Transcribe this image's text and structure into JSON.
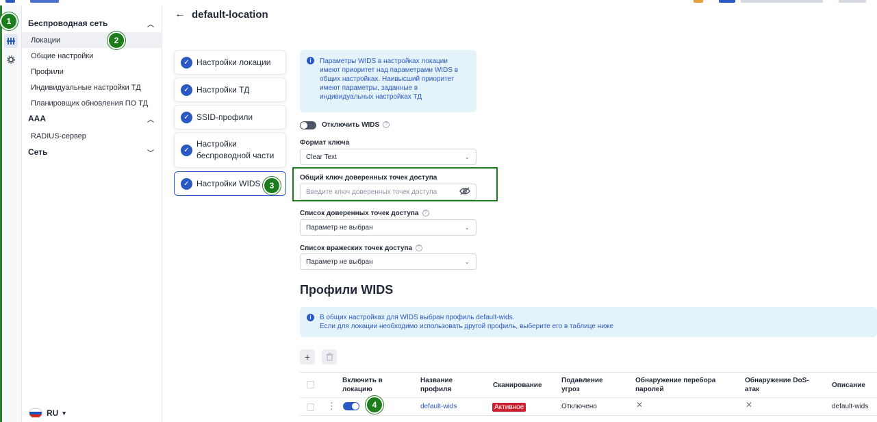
{
  "sidebar": {
    "sections": [
      {
        "label": "Беспроводная сеть"
      },
      {
        "label": "AAA"
      },
      {
        "label": "Сеть"
      }
    ],
    "items": [
      {
        "label": "Локации"
      },
      {
        "label": "Общие настройки"
      },
      {
        "label": "Профили"
      },
      {
        "label": "Индивидуальные настройки ТД"
      },
      {
        "label": "Планировщик обновления ПО ТД"
      },
      {
        "label": "RADIUS-сервер"
      }
    ],
    "language": "RU"
  },
  "page": {
    "title": "default-location"
  },
  "steps": [
    {
      "label": "Настройки локации"
    },
    {
      "label": "Настройки ТД"
    },
    {
      "label": "SSID-профили"
    },
    {
      "label_line1": "Настройки",
      "label_line2": "беспроводной части"
    },
    {
      "label": "Настройки WIDS"
    }
  ],
  "wids_form": {
    "info_lines": [
      "Параметры WIDS в настройках локации",
      "имеют приоритет над параметрами WIDS в",
      "общих настройках. Наивысший приоритет",
      "имеют параметры, заданные в",
      "индивидуальных настройках ТД"
    ],
    "disable_wids_label": "Отключить WIDS",
    "key_format_label": "Формат ключа",
    "key_format_value": "Clear Text",
    "shared_key_label": "Общий ключ доверенных точек доступа",
    "shared_key_placeholder": "Введите ключ доверенных точек доступа",
    "trusted_list_label": "Список доверенных точек доступа",
    "trusted_list_value": "Параметр не выбран",
    "rogue_list_label": "Список вражеских точек доступа",
    "rogue_list_value": "Параметр не выбран"
  },
  "wids_profiles": {
    "heading": "Профили WIDS",
    "info_line1": "В общих настройках для WIDS выбран профиль default-wids.",
    "info_line2": "Если для локации необходимо использовать другой профиль, выберите его в таблице ниже",
    "add_label": "+",
    "columns": [
      {
        "line1": "Включить в",
        "line2": "локацию"
      },
      {
        "line1": "Название",
        "line2": "профиля"
      },
      {
        "line1": "Сканирование",
        "line2": ""
      },
      {
        "line1": "Подавление",
        "line2": "угроз"
      },
      {
        "line1": "Обнаружение перебора",
        "line2": "паролей"
      },
      {
        "line1": "Обнаружение DoS-",
        "line2": "атак"
      },
      {
        "line1": "Описание",
        "line2": ""
      }
    ],
    "rows": [
      {
        "enabled": true,
        "name": "default-wids",
        "scanning": "Активное",
        "threat_suppression": "Отключено",
        "password_bruteforce": "✕",
        "dos_detection": "✕",
        "description": "default-wids"
      }
    ]
  },
  "markers": [
    "1",
    "2",
    "3",
    "4"
  ],
  "colors": {
    "accent": "#2b59c3",
    "marker_green": "#1c7d1c",
    "badge_red": "#cc1f2f",
    "info_bg": "#e4f2fa"
  },
  "icons": [
    "back-arrow-icon",
    "check-circle-icon",
    "info-icon",
    "help-icon",
    "chevron-down-icon",
    "chevron-up-icon",
    "eye-off-icon",
    "trash-icon",
    "kebab-menu-icon",
    "network-icon",
    "gear-icon"
  ]
}
